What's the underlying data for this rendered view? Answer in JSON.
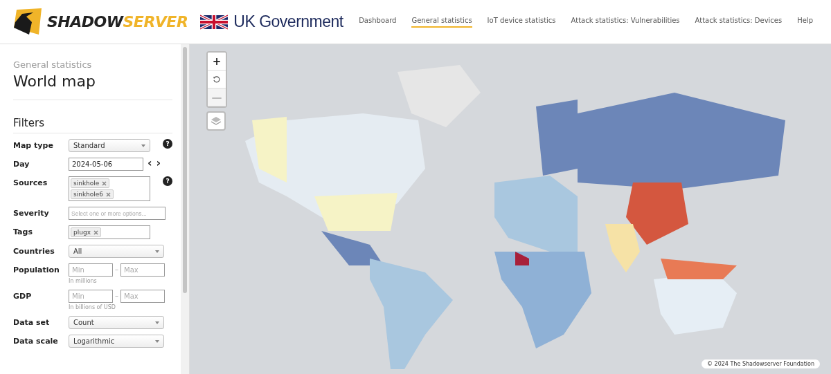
{
  "brand": {
    "part1": "SHADOW",
    "part2": "SERVER"
  },
  "partner": {
    "name": "UK Government"
  },
  "nav": [
    {
      "label": "Dashboard",
      "selected": false
    },
    {
      "label": "General statistics",
      "selected": true
    },
    {
      "label": "IoT device statistics",
      "selected": false
    },
    {
      "label": "Attack statistics: Vulnerabilities",
      "selected": false
    },
    {
      "label": "Attack statistics: Devices",
      "selected": false
    },
    {
      "label": "Help",
      "selected": false
    }
  ],
  "sidebar": {
    "breadcrumb": "General statistics",
    "title": "World map",
    "filters_title": "Filters",
    "filters": [
      {
        "kind": "select",
        "label": "Map type",
        "value": "Standard",
        "help": "?"
      },
      {
        "kind": "date",
        "label": "Day",
        "value": "2024-05-06",
        "prev": "‹",
        "next": "›"
      },
      {
        "kind": "tags",
        "label": "Sources",
        "tags": [
          "sinkhole",
          "sinkhole6"
        ],
        "help": "?"
      },
      {
        "kind": "multiselect",
        "label": "Severity",
        "placeholder": "Select one or more options..."
      },
      {
        "kind": "tags",
        "label": "Tags",
        "tags": [
          "plugx"
        ]
      },
      {
        "kind": "select",
        "label": "Countries",
        "value": "All"
      },
      {
        "kind": "range",
        "label": "Population",
        "min_placeholder": "Min",
        "max_placeholder": "Max",
        "separator": "–",
        "hint": "In millions"
      },
      {
        "kind": "range",
        "label": "GDP",
        "min_placeholder": "Min",
        "max_placeholder": "Max",
        "separator": "–",
        "hint": "In billions of USD"
      },
      {
        "kind": "select",
        "label": "Data set",
        "value": "Count"
      },
      {
        "kind": "select",
        "label": "Data scale",
        "value": "Logarithmic"
      }
    ]
  },
  "map": {
    "kind": "picture",
    "zoom_in": "+",
    "zoom_out": "—",
    "zoom_out_disabled": true,
    "attribution": "© 2024 The Shadowserver Foundation"
  }
}
